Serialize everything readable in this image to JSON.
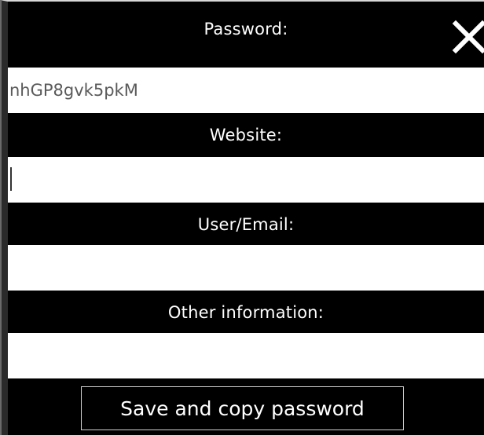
{
  "dialog": {
    "close_icon": "close-icon",
    "fields": [
      {
        "label": "Password:",
        "value": "nhGP8gvk5pkM"
      },
      {
        "label": "Website:",
        "value": ""
      },
      {
        "label": "User/Email:",
        "value": ""
      },
      {
        "label": "Other information:",
        "value": ""
      }
    ],
    "save_label": "Save and copy password"
  },
  "colors": {
    "background": "#000000",
    "field_background": "#ffffff",
    "text": "#ffffff",
    "field_text": "#5a5a5a"
  }
}
